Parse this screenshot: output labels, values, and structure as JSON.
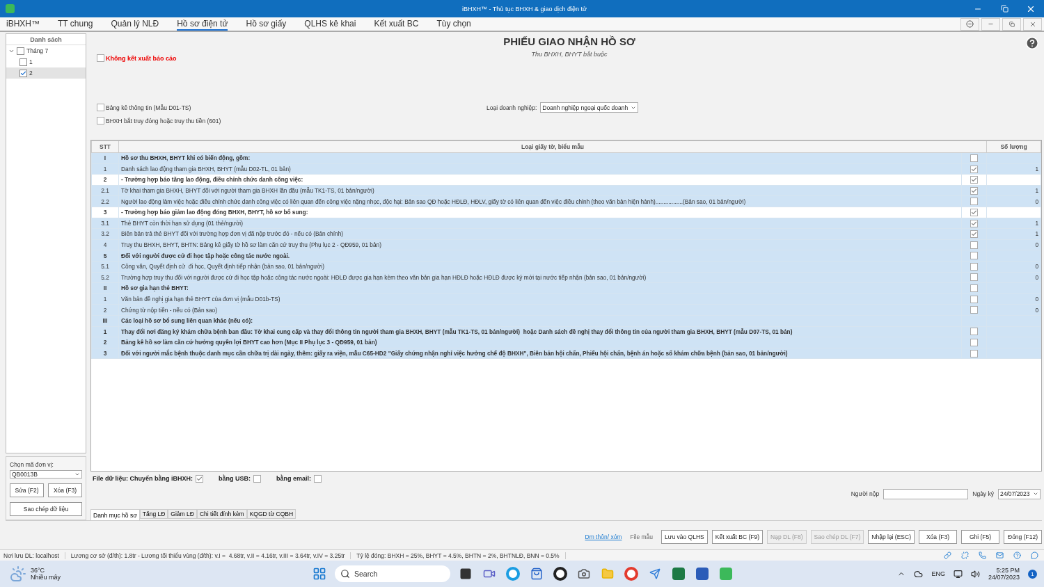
{
  "window": {
    "title": "iBHXH™ - Thủ tục BHXH & giao dịch điện tử"
  },
  "menu": [
    {
      "label": "iBHXH™",
      "selected": false
    },
    {
      "label": "TT chung",
      "selected": false
    },
    {
      "label": "Quản lý NLĐ",
      "selected": false
    },
    {
      "label": "Hồ sơ điện tử",
      "selected": true
    },
    {
      "label": "Hồ sơ giấy",
      "selected": false
    },
    {
      "label": "QLHS kê khai",
      "selected": false
    },
    {
      "label": "Kết xuất BC",
      "selected": false
    },
    {
      "label": "Tùy chọn",
      "selected": false
    }
  ],
  "sidebar": {
    "title": "Danh sách",
    "tree": [
      {
        "label": "Tháng 7",
        "checked": false,
        "expanded": true,
        "selected": false,
        "children": [
          {
            "label": "1",
            "checked": false,
            "selected": false
          },
          {
            "label": "2",
            "checked": true,
            "selected": true
          }
        ]
      }
    ],
    "unit_label": "Chọn mã đơn vị:",
    "unit_value": "QB0013B",
    "buttons": [
      "Sửa (F2)",
      "Xóa (F3)"
    ],
    "copy_button": "Sao chép dữ liệu"
  },
  "form": {
    "title": "PHIẾU GIAO NHẬN HỒ SƠ",
    "subtitle": "Thu BHXH, BHYT bắt buộc",
    "no_export": {
      "label": "Không kết xuất báo cáo",
      "checked": false
    },
    "options": [
      {
        "label": "Bảng kê thông tin (Mẫu D01-TS)",
        "checked": false
      },
      {
        "label": "BHXH bắt truy đóng hoặc truy thu tiền (601)",
        "checked": false
      }
    ],
    "business_type": {
      "label": "Loại doanh nghiệp:",
      "value": "Doanh nghiệp ngoại quốc doanh"
    }
  },
  "table": {
    "columns": [
      "STT",
      "Loại giấy tờ, biểu mẫu",
      "Số lượng"
    ],
    "rows": [
      {
        "stt": "I",
        "text": "Hồ sơ thu BHXH, BHYT khi có biến động, gồm:",
        "kind": "section",
        "checked": false
      },
      {
        "stt": "1",
        "text": "Danh sách lao động tham gia BHXH, BHYT (mẫu D02-TL, 01 bản)",
        "kind": "item",
        "checked": true,
        "qty": "1"
      },
      {
        "stt": "2",
        "text": "- Trường hợp báo tăng lao động, điều chỉnh chức danh công việc:",
        "kind": "group",
        "checked": true
      },
      {
        "stt": "2.1",
        "text": "Tờ khai tham gia BHXH, BHYT đối với người tham gia BHXH lần đầu (mẫu TK1-TS, 01 bản/người)",
        "kind": "item",
        "checked": true,
        "qty": "1"
      },
      {
        "stt": "2.2",
        "text": "Người lao động làm việc hoặc điều chỉnh chức danh công việc có liên quan đến công việc nặng nhọc, độc hại: Bản sao QĐ hoặc HĐLĐ, HĐLV, giấy tờ có liên quan đến việc điều chỉnh (theo văn bản hiện hành).................(Bản sao, 01 bản/người)",
        "kind": "item",
        "checked": false,
        "qty": "0"
      },
      {
        "stt": "3",
        "text": "- Trường hợp báo giảm lao động đóng BHXH, BHYT, hồ sơ bổ sung:",
        "kind": "group",
        "checked": true
      },
      {
        "stt": "3.1",
        "text": "Thẻ BHYT còn thời hạn sử dụng (01 thẻ/người)",
        "kind": "item",
        "checked": true,
        "qty": "1"
      },
      {
        "stt": "3.2",
        "text": "Biên bản trả thẻ BHYT đối với trường hợp đơn vị đã nộp trước đó - nếu có (Bản chính)",
        "kind": "item",
        "checked": true,
        "qty": "1"
      },
      {
        "stt": "4",
        "text": "Truy thu BHXH, BHYT, BHTN: Bảng kê giấy tờ hồ sơ làm căn cứ truy thu (Phụ lục 2 - QĐ959, 01 bản)",
        "kind": "item",
        "checked": false,
        "qty": "0"
      },
      {
        "stt": "5",
        "text": "Đối với người được cử đi học tập hoặc công tác nước ngoài.",
        "kind": "section",
        "checked": false
      },
      {
        "stt": "5.1",
        "text": "Công văn, Quyết định cử  đi học, Quyết định tiếp nhận (bản sao, 01 bản/người)",
        "kind": "item",
        "checked": false,
        "qty": "0"
      },
      {
        "stt": "5.2",
        "text": "Trường hợp truy thu đối với người được cử đi học tập hoặc công tác nước ngoài: HĐLĐ được gia hạn kèm theo văn bản gia hạn HĐLĐ hoặc HĐLĐ được ký mới tại nước tiếp nhận (bản sao, 01 bản/người)",
        "kind": "item",
        "checked": false,
        "qty": "0"
      },
      {
        "stt": "II",
        "text": "Hồ sơ gia hạn thẻ BHYT:",
        "kind": "section",
        "checked": false
      },
      {
        "stt": "1",
        "text": "Văn bản đề nghị gia hạn thẻ BHYT của đơn vị (mẫu D01b-TS)",
        "kind": "item",
        "checked": false,
        "qty": "0"
      },
      {
        "stt": "2",
        "text": "Chứng từ nộp tiền - nếu có (Bản sao)",
        "kind": "item",
        "checked": false,
        "qty": "0"
      },
      {
        "stt": "III",
        "text": "Các loại hồ sơ bổ sung liên quan khác (nếu có):",
        "kind": "section"
      },
      {
        "stt": "1",
        "text": "Thay đổi nơi đăng ký khám chữa bệnh ban đầu: Tờ khai cung cấp và thay đổi thông tin người tham gia BHXH, BHYT (mẫu TK1-TS, 01 bản/người)  hoặc Danh sách đề nghị thay đổi thông tin của người tham gia BHXH, BHYT (mẫu D07-TS, 01 bản)",
        "kind": "section",
        "checked": false
      },
      {
        "stt": "2",
        "text": "Bảng kê hồ sơ làm căn cứ hưởng quyền lợi BHYT cao hơn (Mục II Phụ lục 3 - QĐ959, 01 bản)",
        "kind": "section",
        "checked": false
      },
      {
        "stt": "3",
        "text": "Đối với người mắc bệnh thuộc danh mục cần chữa trị dài ngày, thêm: giấy ra viện, mẫu C65-HD2 \"Giấy chứng nhận nghỉ việc hưởng chế độ BHXH\", Biên bản hội chẩn, Phiếu hội chẩn, bệnh án hoặc sổ khám chữa bệnh (bản sao, 01 bản/người)",
        "kind": "section",
        "checked": false
      }
    ]
  },
  "transfer": {
    "label": "File dữ liệu: Chuyển bằng iBHXH:",
    "checked": true,
    "options": [
      {
        "label": "bằng USB:",
        "checked": false
      },
      {
        "label": "bằng email:",
        "checked": false
      }
    ]
  },
  "submitter": {
    "label": "Người nộp",
    "date_label": "Ngày ký",
    "date": "24/07/2023"
  },
  "bottom_tabs": [
    {
      "label": "Danh mục hồ sơ",
      "selected": true
    },
    {
      "label": "Tăng LĐ",
      "selected": false
    },
    {
      "label": "Giảm LĐ",
      "selected": false
    },
    {
      "label": "Chi tiết đính kèm",
      "selected": false
    },
    {
      "label": "KQGD từ CQBH",
      "selected": false
    }
  ],
  "toolbar": {
    "link": "Dm thôn/ xóm",
    "file_label": "File mẫu",
    "buttons": [
      {
        "label": "Lưu vào QLHS",
        "disabled": false
      },
      {
        "label": "Kết xuất BC (F9)",
        "disabled": false
      },
      {
        "label": "Nạp DL (F8)",
        "disabled": true
      },
      {
        "label": "Sao chép DL (F7)",
        "disabled": true
      },
      {
        "label": "Nhập lại (ESC)",
        "disabled": false
      },
      {
        "label": "Xóa (F3)",
        "disabled": false
      },
      {
        "label": "Ghi (F5)",
        "disabled": false
      },
      {
        "label": "Đóng (F12)",
        "disabled": false
      }
    ]
  },
  "status_bar": [
    "Nơi lưu DL: localhost",
    "Lương cơ sở (đ/th): 1.8tr - Lương tối thiểu vùng (đ/th): v.I =  4.68tr, v.II = 4.16tr, v.III = 3.64tr, v.IV = 3.25tr",
    "Tỷ lệ đóng: BHXH = 25%, BHYT = 4.5%, BHTN = 2%, BHTNLĐ, BNN = 0.5%"
  ],
  "taskbar": {
    "temperature": "36°C",
    "weather": "Nhiều mây",
    "search": "Search",
    "language": "ENG",
    "time": "5:25 PM",
    "date": "24/07/2023",
    "notifications": "1"
  }
}
